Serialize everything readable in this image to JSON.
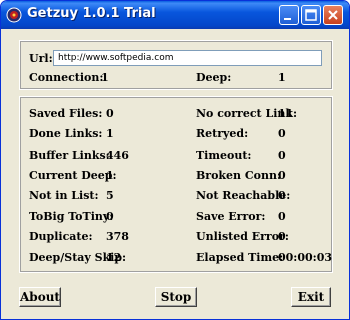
{
  "window": {
    "title": "Getzuy 1.0.1 Trial"
  },
  "url": {
    "label": "Url:",
    "value": "http://www.softpedia.com"
  },
  "connection": {
    "label": "Connection:",
    "value": "1"
  },
  "deep": {
    "label": "Deep:",
    "value": "1"
  },
  "stats_left": [
    {
      "label": "Saved Files:",
      "value": "0"
    },
    {
      "label": "Done Links:",
      "value": "1"
    },
    {
      "label": "Buffer Links:",
      "value": "446"
    },
    {
      "label": "Current Deep:",
      "value": "1"
    },
    {
      "label": "Not in List:",
      "value": "5"
    },
    {
      "label": "ToBig ToTiny:",
      "value": "0"
    },
    {
      "label": "Duplicate:",
      "value": "378"
    },
    {
      "label": "Deep/Stay Skip:",
      "value": "12"
    }
  ],
  "stats_right": [
    {
      "label": "No correct Link:",
      "value": "11"
    },
    {
      "label": "Retryed:",
      "value": "0"
    },
    {
      "label": "Timeout:",
      "value": "0"
    },
    {
      "label": "Broken Conn:",
      "value": "0"
    },
    {
      "label": "Not Reachable:",
      "value": "0"
    },
    {
      "label": "Save Error:",
      "value": "0"
    },
    {
      "label": "Unlisted Error:",
      "value": "0"
    },
    {
      "label": "Elapsed Time:",
      "value": "00:00:03"
    }
  ],
  "buttons": {
    "about": "About",
    "stop": "Stop",
    "exit": "Exit"
  }
}
